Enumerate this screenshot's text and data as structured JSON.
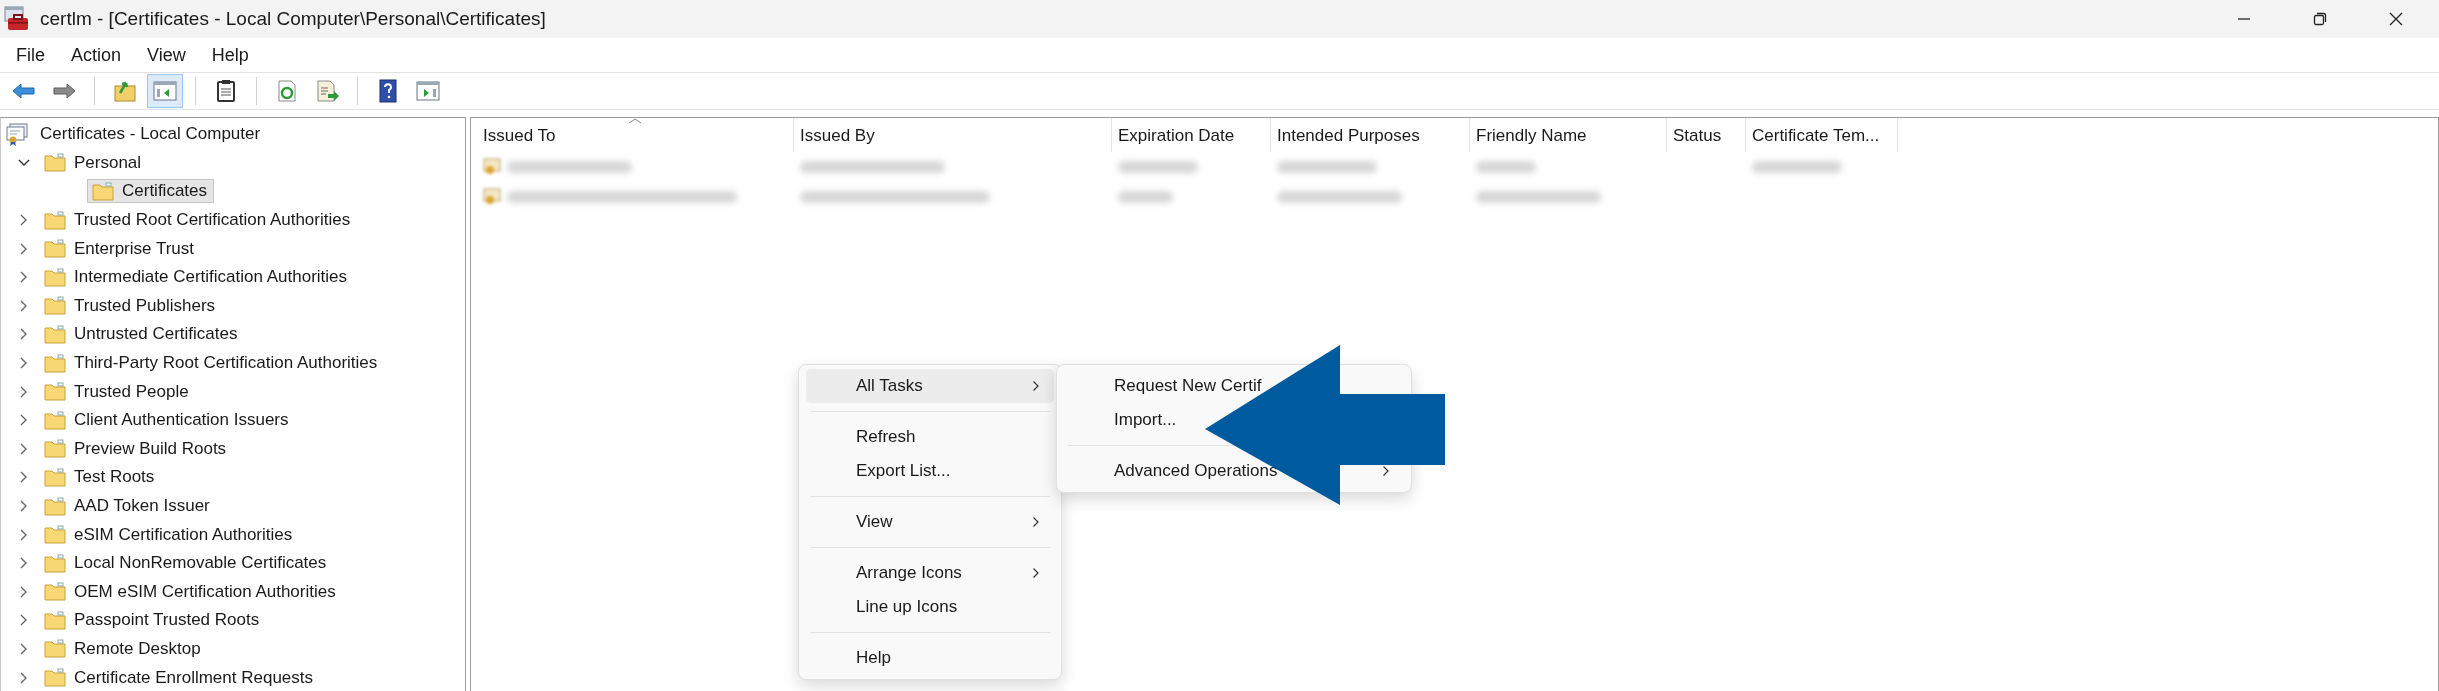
{
  "window": {
    "title": "certlm - [Certificates - Local Computer\\Personal\\Certificates]"
  },
  "menu_bar": [
    "File",
    "Action",
    "View",
    "Help"
  ],
  "toolbar": [
    {
      "kind": "back",
      "pressed": false
    },
    {
      "kind": "forward",
      "pressed": false
    },
    {
      "kind": "separator"
    },
    {
      "kind": "up",
      "pressed": false
    },
    {
      "kind": "tree-toggle",
      "pressed": true
    },
    {
      "kind": "separator"
    },
    {
      "kind": "clipboard",
      "pressed": false
    },
    {
      "kind": "separator"
    },
    {
      "kind": "refresh",
      "pressed": false
    },
    {
      "kind": "export",
      "pressed": false
    },
    {
      "kind": "separator"
    },
    {
      "kind": "help",
      "pressed": false
    },
    {
      "kind": "action-pane",
      "pressed": false
    }
  ],
  "tree": [
    {
      "label": "Certificates - Local Computer",
      "kind": "root",
      "children": [
        {
          "label": "Personal",
          "expanded": true,
          "selected": false,
          "children": [
            {
              "label": "Certificates",
              "selected": true
            }
          ]
        },
        {
          "label": "Trusted Root Certification Authorities",
          "expanded": false,
          "selected": false
        },
        {
          "label": "Enterprise Trust",
          "expanded": false,
          "selected": false
        },
        {
          "label": "Intermediate Certification Authorities",
          "expanded": false,
          "selected": false
        },
        {
          "label": "Trusted Publishers",
          "expanded": false,
          "selected": false
        },
        {
          "label": "Untrusted Certificates",
          "expanded": false,
          "selected": false
        },
        {
          "label": "Third-Party Root Certification Authorities",
          "expanded": false,
          "selected": false
        },
        {
          "label": "Trusted People",
          "expanded": false,
          "selected": false
        },
        {
          "label": "Client Authentication Issuers",
          "expanded": false,
          "selected": false
        },
        {
          "label": "Preview Build Roots",
          "expanded": false,
          "selected": false
        },
        {
          "label": "Test Roots",
          "expanded": false,
          "selected": false
        },
        {
          "label": "AAD Token Issuer",
          "expanded": false,
          "selected": false
        },
        {
          "label": "eSIM Certification Authorities",
          "expanded": false,
          "selected": false
        },
        {
          "label": "Local NonRemovable Certificates",
          "expanded": false,
          "selected": false
        },
        {
          "label": "OEM eSIM Certification Authorities",
          "expanded": false,
          "selected": false
        },
        {
          "label": "Passpoint Trusted Roots",
          "expanded": false,
          "selected": false
        },
        {
          "label": "Remote Desktop",
          "expanded": false,
          "selected": false
        },
        {
          "label": "Certificate Enrollment Requests",
          "expanded": false,
          "selected": false
        }
      ]
    }
  ],
  "table": {
    "columns": [
      {
        "label": "Issued To",
        "sorted": true
      },
      {
        "label": "Issued By",
        "sorted": false
      },
      {
        "label": "Expiration Date",
        "sorted": false
      },
      {
        "label": "Intended Purposes",
        "sorted": false
      },
      {
        "label": "Friendly Name",
        "sorted": false
      },
      {
        "label": "Status",
        "sorted": false
      },
      {
        "label": "Certificate Tem...",
        "sorted": false
      }
    ],
    "rows": [
      {
        "cells": [
          {
            "kind": "blurred"
          },
          {
            "kind": "blurred"
          },
          {
            "kind": "blurred"
          },
          {
            "kind": "blurred"
          },
          {
            "kind": "blurred"
          },
          {
            "kind": "empty"
          },
          {
            "kind": "blurred"
          }
        ]
      },
      {
        "cells": [
          {
            "kind": "blurred"
          },
          {
            "kind": "blurred"
          },
          {
            "kind": "blurred"
          },
          {
            "kind": "blurred"
          },
          {
            "kind": "blurred"
          },
          {
            "kind": "empty"
          },
          {
            "kind": "empty"
          }
        ]
      }
    ]
  },
  "context_menu": {
    "items": [
      {
        "kind": "item",
        "label": "All Tasks",
        "submenu": true,
        "highlighted": true
      },
      {
        "kind": "separator"
      },
      {
        "kind": "item",
        "label": "Refresh",
        "submenu": false,
        "highlighted": false
      },
      {
        "kind": "item",
        "label": "Export List...",
        "submenu": false,
        "highlighted": false
      },
      {
        "kind": "separator"
      },
      {
        "kind": "item",
        "label": "View",
        "submenu": true,
        "highlighted": false
      },
      {
        "kind": "separator"
      },
      {
        "kind": "item",
        "label": "Arrange Icons",
        "submenu": true,
        "highlighted": false
      },
      {
        "kind": "item",
        "label": "Line up Icons",
        "submenu": false,
        "highlighted": false
      },
      {
        "kind": "separator"
      },
      {
        "kind": "item",
        "label": "Help",
        "submenu": false,
        "highlighted": false
      }
    ]
  },
  "submenu": {
    "items": [
      {
        "kind": "item",
        "label": "Request New Certif",
        "submenu": false,
        "highlighted": false
      },
      {
        "kind": "item",
        "label": "Import...",
        "submenu": false,
        "highlighted": false
      },
      {
        "kind": "separator"
      },
      {
        "kind": "item",
        "label": "Advanced Operations",
        "submenu": true,
        "highlighted": false
      }
    ]
  }
}
